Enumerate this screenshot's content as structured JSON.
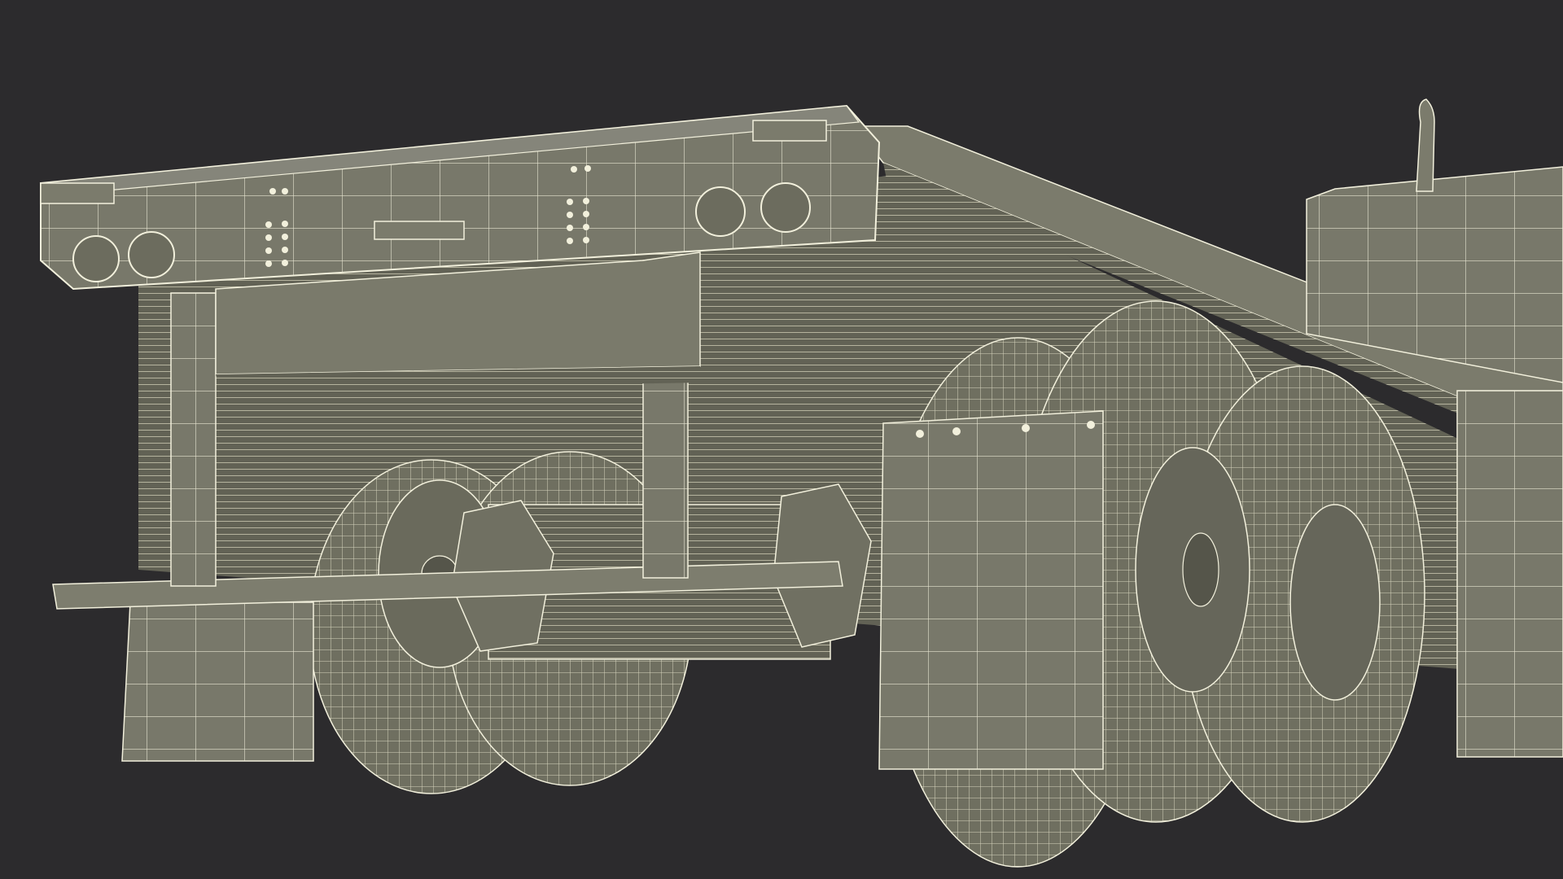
{
  "render": {
    "subject": "",
    "style": "",
    "background_color": "#2c2b2d",
    "surface_color": "#7a7a68",
    "surface_dark_color": "#5f5f52",
    "wire_color": "#f2f0dc"
  }
}
